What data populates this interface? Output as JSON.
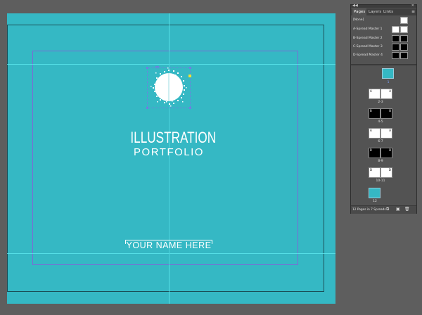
{
  "document": {
    "title_line_1": "ILLUSTRATION",
    "title_line_2": "PORTFOLIO",
    "name_placeholder": "YOUR NAME HERE",
    "background_color": "#35b8c4"
  },
  "pages_panel": {
    "tabs": [
      {
        "label": "Pages",
        "active": true
      },
      {
        "label": "Layers",
        "active": false
      },
      {
        "label": "Links",
        "active": false
      }
    ],
    "menu_icon": "panel-menu-icon",
    "masters": [
      {
        "label": "[None]",
        "thumb": "white-single"
      },
      {
        "label": "A-Spread Master 1",
        "thumb": "white-spread"
      },
      {
        "label": "B-Spread Master 2",
        "thumb": "black-spread"
      },
      {
        "label": "C-Spread Master 3",
        "thumb": "black-spread"
      },
      {
        "label": "D-Spread Master 4",
        "thumb": "black-spread"
      }
    ],
    "page_groups": [
      {
        "number": "1",
        "type": "cover"
      },
      {
        "number": "2-3",
        "master": "A",
        "style": "white"
      },
      {
        "number": "4-5",
        "master": "B",
        "style": "black"
      },
      {
        "number": "6-7",
        "master": "A",
        "style": "white"
      },
      {
        "number": "8-9",
        "master": "B",
        "style": "black"
      },
      {
        "number": "10-11",
        "master": "D",
        "style": "white"
      },
      {
        "number": "12",
        "type": "cover"
      }
    ],
    "footer_text": "12 Pages in 7 Spreads",
    "footer_icons": [
      "page-size-icon",
      "new-page-icon",
      "delete-page-icon"
    ]
  }
}
